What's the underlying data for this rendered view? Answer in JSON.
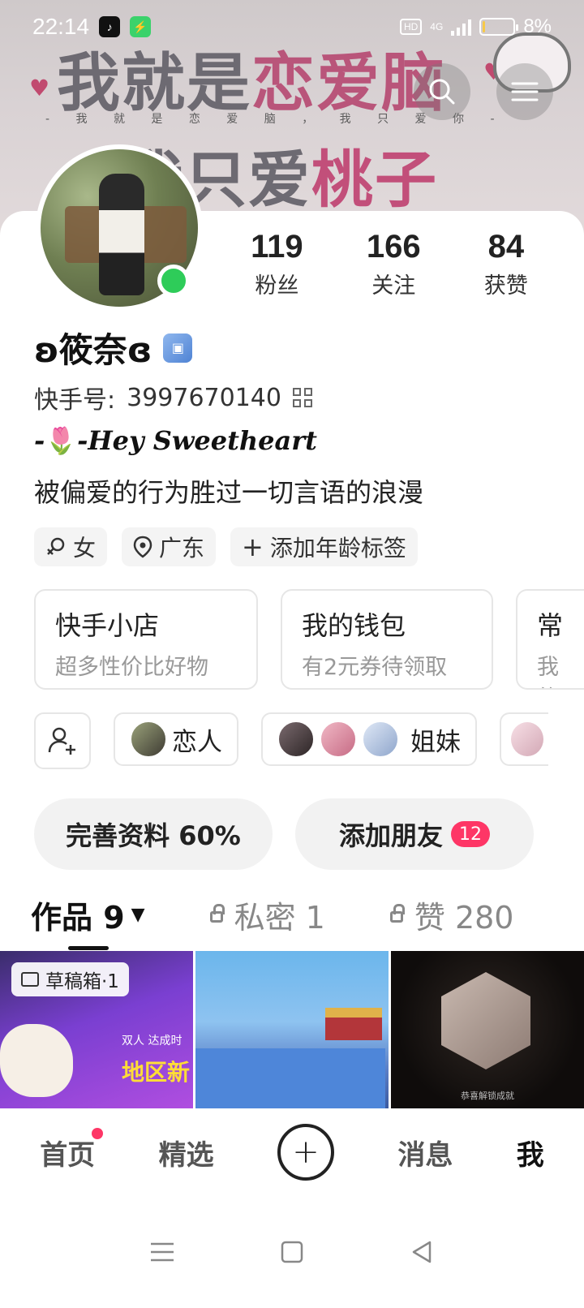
{
  "status_bar": {
    "time": "22:14",
    "network": "4G",
    "hd_label": "HD",
    "battery_percent": "8%",
    "battery_level": 0.08
  },
  "banner": {
    "line1_a": "我就是",
    "line1_b": "恋爱脑",
    "subline": "- 我 就 是 恋 爱 脑 ， 我 只 爱 你 -",
    "line2_a": "我只爱",
    "line2_b": "桃子"
  },
  "header": {
    "search_icon": "search-icon",
    "menu_icon": "menu-icon"
  },
  "profile": {
    "name": "ʚ筱奈ɞ",
    "id_label": "快手号:",
    "id_value": "3997670140",
    "bio_line1_prefix": "-",
    "bio_line1_emoji": "🌷",
    "bio_line1_text": "-Hey Sweetheart",
    "bio_line2": "被偏爱的行为胜过一切言语的浪漫",
    "online_color": "#2ecc59"
  },
  "stats": [
    {
      "num": "119",
      "label": "粉丝"
    },
    {
      "num": "166",
      "label": "关注"
    },
    {
      "num": "84",
      "label": "获赞"
    }
  ],
  "tags": {
    "gender": "女",
    "location": "广东",
    "add_age": "添加年龄标签"
  },
  "cards": [
    {
      "title": "快手小店",
      "sub": "超多性价比好物"
    },
    {
      "title": "我的钱包",
      "sub": "有2元券待领取"
    },
    {
      "title": "常",
      "sub": "我的"
    }
  ],
  "friend_groups": [
    {
      "label": "恋人"
    },
    {
      "label": "姐妹"
    }
  ],
  "actions": {
    "complete_profile": "完善资料 60%",
    "add_friend": "添加朋友",
    "add_friend_count": "12"
  },
  "tabs": {
    "works": "作品 9",
    "private": "私密 1",
    "likes": "赞 280"
  },
  "grid": {
    "draft_label": "草稿箱·1",
    "tile1_text": "地区新",
    "tile1_tag": "双人 达成时",
    "tile3_caption": "恭喜解锁成就"
  },
  "bottom_nav": {
    "home": "首页",
    "featured": "精选",
    "messages": "消息",
    "me": "我",
    "accent": "#fe3666"
  }
}
